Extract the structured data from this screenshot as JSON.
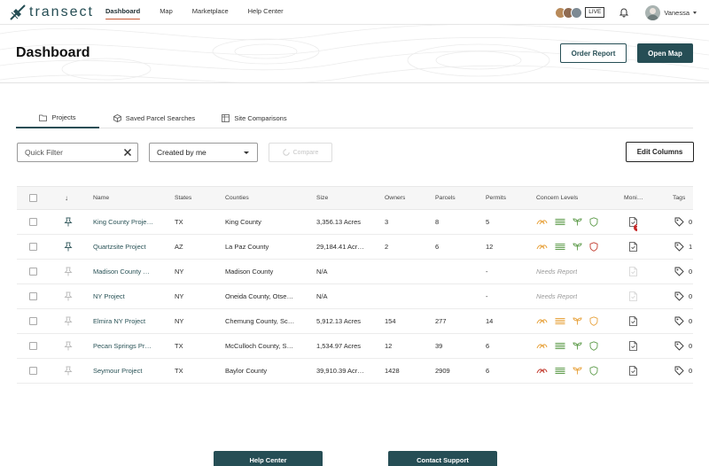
{
  "app": {
    "brand": "transect"
  },
  "nav": {
    "links": [
      "Dashboard",
      "Map",
      "Marketplace",
      "Help Center"
    ],
    "active": "Dashboard",
    "live_label": "LIVE",
    "user_name": "Vanessa"
  },
  "header": {
    "title": "Dashboard",
    "order_report": "Order Report",
    "open_map": "Open Map"
  },
  "tabs": [
    {
      "label": "Projects",
      "icon": "folder-icon",
      "active": true
    },
    {
      "label": "Saved Parcel Searches",
      "icon": "box-icon",
      "active": false
    },
    {
      "label": "Site Comparisons",
      "icon": "columns-icon",
      "active": false
    }
  ],
  "filters": {
    "quick_filter_placeholder": "Quick Filter",
    "created_by": "Created by me",
    "compare": "Compare",
    "edit_columns": "Edit Columns"
  },
  "table": {
    "sort_glyph": "↓",
    "columns": [
      "Name",
      "States",
      "Counties",
      "Size",
      "Owners",
      "Parcels",
      "Permits",
      "Concern Levels",
      "Moni…",
      "Tags"
    ],
    "rows": [
      {
        "name": "King County Proje…",
        "state": "TX",
        "county": "King County",
        "size": "3,356.13 Acres",
        "owners": "3",
        "parcels": "8",
        "permits": "5",
        "pinned": true,
        "concern": [
          "orange",
          "green",
          "green",
          "green"
        ],
        "monitor_badge": "7",
        "tags": "0"
      },
      {
        "name": "Quartzsite Project",
        "state": "AZ",
        "county": "La Paz County",
        "size": "29,184.41 Acr…",
        "owners": "2",
        "parcels": "6",
        "permits": "12",
        "pinned": true,
        "concern": [
          "orange",
          "green",
          "green",
          "red"
        ],
        "monitor_badge": "",
        "tags": "1"
      },
      {
        "name": "Madison County …",
        "state": "NY",
        "county": "Madison County",
        "size": "N/A",
        "owners": "",
        "parcels": "",
        "permits": "-",
        "pinned": false,
        "concern_text": "Needs Report",
        "monitor_badge": "",
        "tags": "0"
      },
      {
        "name": "NY Project",
        "state": "NY",
        "county": "Oneida County, Otse…",
        "size": "N/A",
        "owners": "",
        "parcels": "",
        "permits": "-",
        "pinned": false,
        "concern_text": "Needs Report",
        "monitor_badge": "",
        "tags": "0"
      },
      {
        "name": "Elmira NY Project",
        "state": "NY",
        "county": "Chemung County, Sc…",
        "size": "5,912.13 Acres",
        "owners": "154",
        "parcels": "277",
        "permits": "14",
        "pinned": false,
        "concern": [
          "orange",
          "orange",
          "orange",
          "orange"
        ],
        "monitor_badge": "",
        "tags": "0"
      },
      {
        "name": "Pecan Springs Pr…",
        "state": "TX",
        "county": "McCulloch County, S…",
        "size": "1,534.97 Acres",
        "owners": "12",
        "parcels": "39",
        "permits": "6",
        "pinned": false,
        "concern": [
          "orange",
          "green",
          "green",
          "green"
        ],
        "monitor_badge": "",
        "tags": "0"
      },
      {
        "name": "Seymour Project",
        "state": "TX",
        "county": "Baylor County",
        "size": "39,910.39 Acr…",
        "owners": "1428",
        "parcels": "2909",
        "permits": "6",
        "pinned": false,
        "concern": [
          "red",
          "green",
          "orange",
          "green"
        ],
        "monitor_badge": "",
        "tags": "0"
      }
    ]
  },
  "footer": {
    "help_center": "Help Center",
    "contact_support": "Contact Support"
  },
  "colors": {
    "brand": "#264e55",
    "accent": "#c65a35",
    "concern_orange": "#e7a13a",
    "concern_green": "#5d9b4a",
    "concern_red": "#c23b2e"
  }
}
